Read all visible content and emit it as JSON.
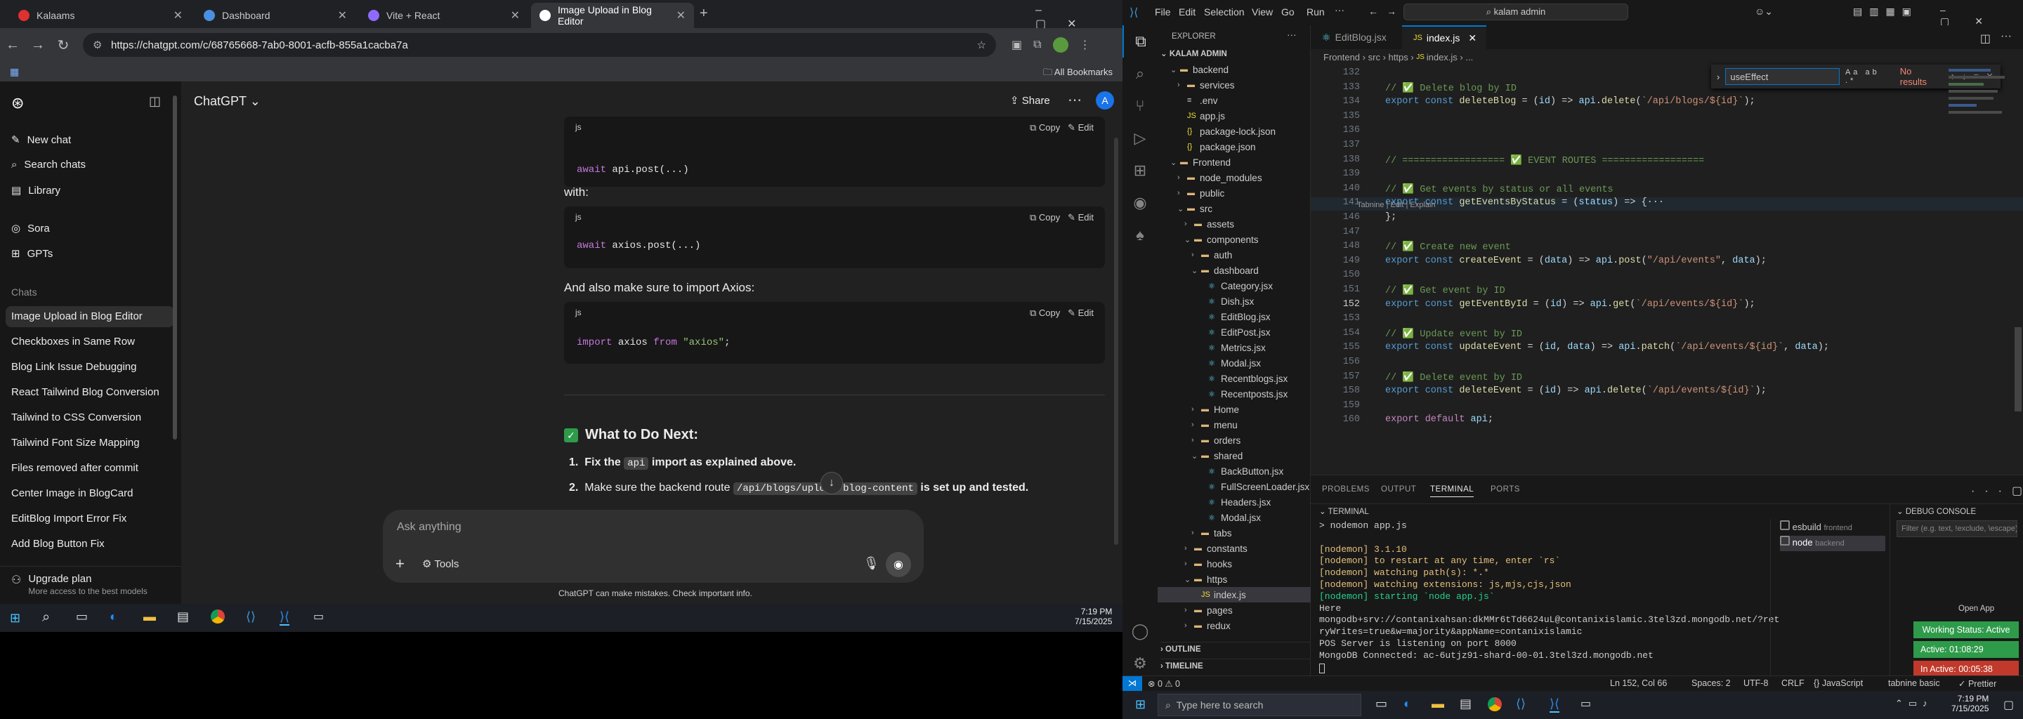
{
  "browser": {
    "tabs": [
      {
        "label": "Kalaams"
      },
      {
        "label": "Dashboard"
      },
      {
        "label": "Vite + React"
      },
      {
        "label": "Image Upload in Blog Editor"
      }
    ],
    "url": "https://chatgpt.com/c/68765668-7ab0-8001-acfb-855a1cacba7a",
    "bookmarks_label": "All Bookmarks"
  },
  "chatgpt": {
    "model_label": "ChatGPT",
    "share_label": "Share",
    "avatar_letter": "A",
    "sidebar": {
      "new_chat": "New chat",
      "search": "Search chats",
      "library": "Library",
      "sora": "Sora",
      "gpts": "GPTs",
      "chats_heading": "Chats",
      "chats": [
        "Image Upload in Blog Editor",
        "Checkboxes in Same Row",
        "Blog Link Issue Debugging",
        "React Tailwind Blog Conversion",
        "Tailwind to CSS Conversion",
        "Tailwind Font Size Mapping",
        "Files removed after commit",
        "Center Image in BlogCard",
        "EditBlog Import Error Fix",
        "Add Blog Button Fix"
      ],
      "upgrade_title": "Upgrade plan",
      "upgrade_sub": "More access to the best models"
    },
    "messages": {
      "code_lang": "js",
      "copy": "Copy",
      "edit": "Edit",
      "code1_kw": "await",
      "code1_rest": " api.post(...)",
      "with_text": "with:",
      "code2_kw": "await",
      "code2_rest": " axios.post(...)",
      "import_text": "And also make sure to import Axios:",
      "code3_kw": "import",
      "code3_mid": " axios ",
      "code3_from": "from",
      "code3_str": " \"axios\"",
      "code3_end": ";",
      "next_heading": "What to Do Next:",
      "step1_num": "1.",
      "step1_a": "Fix the ",
      "step1_code": "api",
      "step1_b": " import as explained above.",
      "step2_num": "2.",
      "step2_a": "Make sure the backend route ",
      "step2_code": "/api/blogs/upload-blog-content",
      "step2_b": " is set up and tested."
    },
    "composer": {
      "placeholder": "Ask anything",
      "tools": "Tools"
    },
    "disclaimer": "ChatGPT can make mistakes. Check important info."
  },
  "left_taskbar": {
    "time": "7:19 PM",
    "date": "7/15/2025"
  },
  "vscode": {
    "menu": [
      "File",
      "Edit",
      "Selection",
      "View",
      "Go",
      "Run"
    ],
    "search_box": "kalam admin",
    "explorer_title": "EXPLORER",
    "workspace": "KALAM ADMIN",
    "tree": [
      {
        "label": "backend",
        "depth": 1,
        "kind": "folder-open"
      },
      {
        "label": "services",
        "depth": 2,
        "kind": "folder"
      },
      {
        "label": ".env",
        "depth": 2,
        "kind": "file"
      },
      {
        "label": "app.js",
        "depth": 2,
        "kind": "js"
      },
      {
        "label": "package-lock.json",
        "depth": 2,
        "kind": "json"
      },
      {
        "label": "package.json",
        "depth": 2,
        "kind": "json"
      },
      {
        "label": "Frontend",
        "depth": 1,
        "kind": "folder-open"
      },
      {
        "label": "node_modules",
        "depth": 2,
        "kind": "folder"
      },
      {
        "label": "public",
        "depth": 2,
        "kind": "folder"
      },
      {
        "label": "src",
        "depth": 2,
        "kind": "folder-open"
      },
      {
        "label": "assets",
        "depth": 3,
        "kind": "folder"
      },
      {
        "label": "components",
        "depth": 3,
        "kind": "folder-open"
      },
      {
        "label": "auth",
        "depth": 4,
        "kind": "folder"
      },
      {
        "label": "dashboard",
        "depth": 4,
        "kind": "folder-open"
      },
      {
        "label": "Category.jsx",
        "depth": 5,
        "kind": "jsx"
      },
      {
        "label": "Dish.jsx",
        "depth": 5,
        "kind": "jsx"
      },
      {
        "label": "EditBlog.jsx",
        "depth": 5,
        "kind": "jsx"
      },
      {
        "label": "EditPost.jsx",
        "depth": 5,
        "kind": "jsx"
      },
      {
        "label": "Metrics.jsx",
        "depth": 5,
        "kind": "jsx"
      },
      {
        "label": "Modal.jsx",
        "depth": 5,
        "kind": "jsx"
      },
      {
        "label": "Recentblogs.jsx",
        "depth": 5,
        "kind": "jsx"
      },
      {
        "label": "Recentposts.jsx",
        "depth": 5,
        "kind": "jsx"
      },
      {
        "label": "Home",
        "depth": 4,
        "kind": "folder"
      },
      {
        "label": "menu",
        "depth": 4,
        "kind": "folder"
      },
      {
        "label": "orders",
        "depth": 4,
        "kind": "folder"
      },
      {
        "label": "shared",
        "depth": 4,
        "kind": "folder-open"
      },
      {
        "label": "BackButton.jsx",
        "depth": 5,
        "kind": "jsx"
      },
      {
        "label": "FullScreenLoader.jsx",
        "depth": 5,
        "kind": "jsx"
      },
      {
        "label": "Headers.jsx",
        "depth": 5,
        "kind": "jsx"
      },
      {
        "label": "Modal.jsx",
        "depth": 5,
        "kind": "jsx"
      },
      {
        "label": "tabs",
        "depth": 4,
        "kind": "folder"
      },
      {
        "label": "constants",
        "depth": 3,
        "kind": "folder"
      },
      {
        "label": "hooks",
        "depth": 3,
        "kind": "folder"
      },
      {
        "label": "https",
        "depth": 3,
        "kind": "folder-open"
      },
      {
        "label": "index.js",
        "depth": 4,
        "kind": "js",
        "selected": true
      },
      {
        "label": "pages",
        "depth": 3,
        "kind": "folder"
      },
      {
        "label": "redux",
        "depth": 3,
        "kind": "folder"
      }
    ],
    "outline": "OUTLINE",
    "timeline": "TIMELINE",
    "editor_tabs": [
      "EditBlog.jsx",
      "index.js"
    ],
    "breadcrumb": [
      "Frontend",
      "src",
      "https",
      "index.js",
      "..."
    ],
    "find": {
      "query": "useEffect",
      "result": "No results"
    },
    "code_lines": [
      {
        "n": "132",
        "parts": []
      },
      {
        "n": "133",
        "parts": [
          [
            "c-com",
            "// ✅ Delete blog by ID"
          ]
        ]
      },
      {
        "n": "134",
        "parts": [
          [
            "c-kw",
            "export const "
          ],
          [
            "c-fn",
            "deleteBlog"
          ],
          [
            "c-pu",
            " = ("
          ],
          [
            "c-var",
            "id"
          ],
          [
            "c-pu",
            ") => "
          ],
          [
            "c-var",
            "api"
          ],
          [
            "c-pu",
            "."
          ],
          [
            "c-fn",
            "delete"
          ],
          [
            "c-pu",
            "("
          ],
          [
            "c-str",
            "`/api/blogs/${id}`"
          ],
          [
            "c-pu",
            ");"
          ]
        ]
      },
      {
        "n": "135",
        "parts": []
      },
      {
        "n": "136",
        "parts": []
      },
      {
        "n": "137",
        "parts": []
      },
      {
        "n": "138",
        "parts": [
          [
            "c-com",
            "// ================== ✅ EVENT ROUTES =================="
          ]
        ]
      },
      {
        "n": "139",
        "parts": []
      },
      {
        "n": "140",
        "parts": [
          [
            "c-com",
            "// ✅ Get events by status or all events"
          ]
        ]
      },
      {
        "n": "141",
        "parts": [
          [
            "c-kw",
            "export const "
          ],
          [
            "c-fn",
            "getEventsByStatus"
          ],
          [
            "c-pu",
            " = ("
          ],
          [
            "c-var",
            "status"
          ],
          [
            "c-pu",
            ") => {···"
          ]
        ]
      },
      {
        "n": "146",
        "parts": [
          [
            "c-pu",
            "};"
          ]
        ]
      },
      {
        "n": "147",
        "parts": []
      },
      {
        "n": "148",
        "parts": [
          [
            "c-com",
            "// ✅ Create new event"
          ]
        ]
      },
      {
        "n": "149",
        "parts": [
          [
            "c-kw",
            "export const "
          ],
          [
            "c-fn",
            "createEvent"
          ],
          [
            "c-pu",
            " = ("
          ],
          [
            "c-var",
            "data"
          ],
          [
            "c-pu",
            ") => "
          ],
          [
            "c-var",
            "api"
          ],
          [
            "c-pu",
            "."
          ],
          [
            "c-fn",
            "post"
          ],
          [
            "c-pu",
            "("
          ],
          [
            "c-str",
            "\"/api/events\""
          ],
          [
            "c-pu",
            ", "
          ],
          [
            "c-var",
            "data"
          ],
          [
            "c-pu",
            ");"
          ]
        ]
      },
      {
        "n": "150",
        "parts": []
      },
      {
        "n": "151",
        "parts": [
          [
            "c-com",
            "// ✅ Get event by ID"
          ]
        ]
      },
      {
        "n": "152",
        "parts": [
          [
            "c-kw",
            "export const "
          ],
          [
            "c-fn",
            "getEventById"
          ],
          [
            "c-pu",
            " = ("
          ],
          [
            "c-var",
            "id"
          ],
          [
            "c-pu",
            ") => "
          ],
          [
            "c-var",
            "api"
          ],
          [
            "c-pu",
            "."
          ],
          [
            "c-fn",
            "get"
          ],
          [
            "c-pu",
            "("
          ],
          [
            "c-str",
            "`/api/events/${id}`"
          ],
          [
            "c-pu",
            ");"
          ]
        ]
      },
      {
        "n": "153",
        "parts": []
      },
      {
        "n": "154",
        "parts": [
          [
            "c-com",
            "// ✅ Update event by ID"
          ]
        ]
      },
      {
        "n": "155",
        "parts": [
          [
            "c-kw",
            "export const "
          ],
          [
            "c-fn",
            "updateEvent"
          ],
          [
            "c-pu",
            " = ("
          ],
          [
            "c-var",
            "id"
          ],
          [
            "c-pu",
            ", "
          ],
          [
            "c-var",
            "data"
          ],
          [
            "c-pu",
            ") => "
          ],
          [
            "c-var",
            "api"
          ],
          [
            "c-pu",
            "."
          ],
          [
            "c-fn",
            "patch"
          ],
          [
            "c-pu",
            "("
          ],
          [
            "c-str",
            "`/api/events/${id}`"
          ],
          [
            "c-pu",
            ", "
          ],
          [
            "c-var",
            "data"
          ],
          [
            "c-pu",
            ");"
          ]
        ]
      },
      {
        "n": "156",
        "parts": []
      },
      {
        "n": "157",
        "parts": [
          [
            "c-com",
            "// ✅ Delete event by ID"
          ]
        ]
      },
      {
        "n": "158",
        "parts": [
          [
            "c-kw",
            "export const "
          ],
          [
            "c-fn",
            "deleteEvent"
          ],
          [
            "c-pu",
            " = ("
          ],
          [
            "c-var",
            "id"
          ],
          [
            "c-pu",
            ") => "
          ],
          [
            "c-var",
            "api"
          ],
          [
            "c-pu",
            "."
          ],
          [
            "c-fn",
            "delete"
          ],
          [
            "c-pu",
            "("
          ],
          [
            "c-str",
            "`/api/events/${id}`"
          ],
          [
            "c-pu",
            ");"
          ]
        ]
      },
      {
        "n": "159",
        "parts": []
      },
      {
        "n": "160",
        "parts": [
          [
            "c-k2",
            "export default "
          ],
          [
            "c-var",
            "api"
          ],
          [
            "c-pu",
            ";"
          ]
        ]
      }
    ],
    "codelens": "Tabnine | Edit | Explain",
    "panel_tabs": [
      "PROBLEMS",
      "OUTPUT",
      "TERMINAL",
      "PORTS"
    ],
    "terminal_heading": "TERMINAL",
    "debug_heading": "DEBUG CONSOLE",
    "debug_filter": "Filter (e.g. text, !exclude, \\escape)",
    "terminal_lines": [
      {
        "t": "> nodemon app.js",
        "c": "#cccccc"
      },
      {
        "t": "",
        "c": "#cccccc"
      },
      {
        "t": "[nodemon] 3.1.10",
        "c": "#e5c07b"
      },
      {
        "t": "[nodemon] to restart at any time, enter `rs`",
        "c": "#e5c07b"
      },
      {
        "t": "[nodemon] watching path(s): *.*",
        "c": "#e5c07b"
      },
      {
        "t": "[nodemon] watching extensions: js,mjs,cjs,json",
        "c": "#e5c07b"
      },
      {
        "t": "[nodemon] starting `node app.js`",
        "c": "#23d18b"
      },
      {
        "t": "Here",
        "c": "#cccccc"
      },
      {
        "t": "mongodb+srv://contanixahsan:dkMMr6tTd6624uL@contanixislamic.3tel3zd.mongodb.net/?ret",
        "c": "#cccccc"
      },
      {
        "t": "ryWrites=true&w=majority&appName=contanixislamic",
        "c": "#cccccc"
      },
      {
        "t": "POS Server is listening on port 8000",
        "c": "#cccccc"
      },
      {
        "t": "MongoDB Connected: ac-6utjz91-shard-00-01.3tel3zd.mongodb.net",
        "c": "#cccccc"
      }
    ],
    "terminals": [
      {
        "name": "esbuild",
        "sub": "frontend"
      },
      {
        "name": "node",
        "sub": "backend"
      }
    ],
    "open_app": "Open App",
    "working_status": "Working Status: Active",
    "active_time": "Active: 01:08:29",
    "inactive_time": "In Active: 00:05:38",
    "status": {
      "left": "⊗ 0 ⚠ 0",
      "cursor": "Ln 152, Col 66",
      "spaces": "Spaces: 2",
      "encoding": "UTF-8",
      "eol": "CRLF",
      "lang": "{} JavaScript",
      "tabnine": "tabnine basic",
      "prettier": "✓ Prettier"
    },
    "search_placeholder": "Type here to search",
    "clock_time": "7:19 PM",
    "clock_date": "7/15/2025"
  }
}
